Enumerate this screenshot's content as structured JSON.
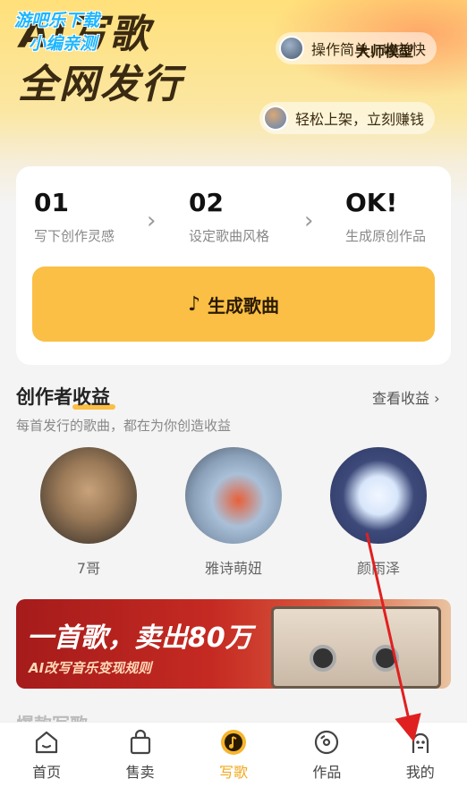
{
  "hero": {
    "title_line1": "AI写歌",
    "title_line2": "全网发行",
    "pill1_text": "操作简单，收益快",
    "pill1_overlap": "大师模型",
    "pill2_text": "轻松上架，立刻赚钱"
  },
  "watermark": {
    "line1": "游吧乐下载",
    "line2": "小编亲测"
  },
  "steps": [
    {
      "num": "01",
      "desc": "写下创作灵感"
    },
    {
      "num": "02",
      "desc": "设定歌曲风格"
    },
    {
      "num": "OK!",
      "desc": "生成原创作品"
    }
  ],
  "generate_button": "生成歌曲",
  "earnings": {
    "title_a": "创作者",
    "title_b": "收益",
    "see_more": "查看收益",
    "subtitle": "每首发行的歌曲，都在为你创造收益"
  },
  "creators": [
    {
      "name": "7哥"
    },
    {
      "name": "雅诗萌妞"
    },
    {
      "name": "颜雨泽"
    }
  ],
  "banner": {
    "headline": "一首歌，卖出80万",
    "sub": "AI改写音乐变现规则"
  },
  "peek_text": "爆款写歌",
  "tabs": [
    {
      "label": "首页",
      "icon": "home-icon"
    },
    {
      "label": "售卖",
      "icon": "shopping-bag-icon"
    },
    {
      "label": "写歌",
      "icon": "music-note-icon",
      "active": true
    },
    {
      "label": "作品",
      "icon": "disc-icon"
    },
    {
      "label": "我的",
      "icon": "profile-face-icon"
    }
  ],
  "colors": {
    "accent": "#fbbf45",
    "active_tab": "#f0a81c",
    "annotation_arrow": "#e02020"
  }
}
